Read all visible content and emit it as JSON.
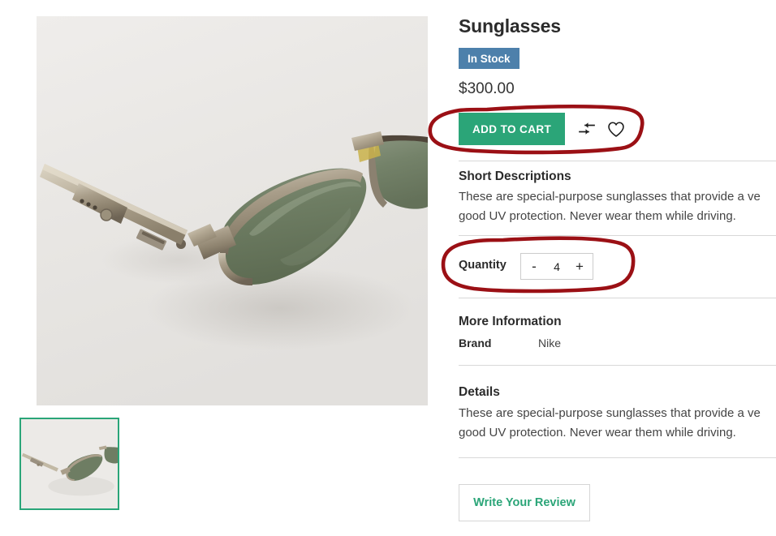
{
  "product": {
    "title": "Sunglasses",
    "stock_badge": "In Stock",
    "price": "$300.00",
    "brand_label": "Brand",
    "brand_value": "Nike"
  },
  "actions": {
    "add_to_cart_label": "ADD TO CART",
    "compare_icon": "compare-arrows-icon",
    "wishlist_icon": "heart-icon"
  },
  "quantity": {
    "label": "Quantity",
    "decrement_label": "-",
    "value": "4",
    "increment_label": "+"
  },
  "short_description": {
    "heading": "Short Descriptions",
    "line1": "These are special-purpose sunglasses that provide a ve",
    "line2": "good UV protection. Never wear them while driving."
  },
  "more_information": {
    "heading": "More Information"
  },
  "details": {
    "heading": "Details",
    "line1": "These are special-purpose sunglasses that provide a ve",
    "line2": "good UV protection. Never wear them while driving."
  },
  "review": {
    "button_label": "Write Your Review"
  },
  "gallery": {
    "main_image_alt": "sunglasses-product-photo",
    "thumbnail_alt": "sunglasses-thumbnail"
  },
  "colors": {
    "accent_green": "#2ba578",
    "badge_blue": "#4d80ab",
    "annotation_red": "#9b1015",
    "divider_gray": "#d8d8d8",
    "text_dark": "#2b2b2b"
  },
  "annotations": {
    "highlight_1": "add-to-cart-row-circled",
    "highlight_2": "quantity-row-circled"
  }
}
